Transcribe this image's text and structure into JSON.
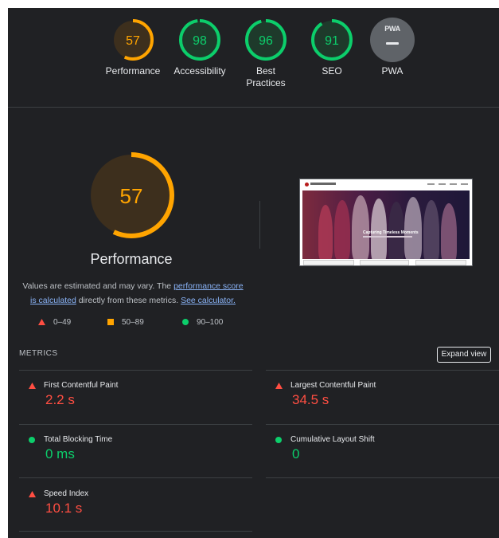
{
  "summary": {
    "gauges": [
      {
        "id": "performance",
        "score": 57,
        "label": "Performance",
        "color": "#ffa400",
        "fill": "#3d2f1d"
      },
      {
        "id": "accessibility",
        "score": 98,
        "label": "Accessibility",
        "color": "#0cce6b",
        "fill": "#1e3a2b"
      },
      {
        "id": "best_practices",
        "score": 96,
        "label": "Best Practices",
        "color": "#0cce6b",
        "fill": "#1e3a2b"
      },
      {
        "id": "seo",
        "score": 91,
        "label": "SEO",
        "color": "#0cce6b",
        "fill": "#1e3a2b"
      }
    ],
    "pwa": {
      "badge": "PWA",
      "label": "PWA"
    }
  },
  "performance": {
    "score": 57,
    "title": "Performance",
    "desc_prefix": "Values are estimated and may vary. The ",
    "link1": "performance score is calculated",
    "desc_middle": " directly from these metrics. ",
    "link2": "See calculator.",
    "legend": [
      {
        "shape": "triangle",
        "color": "#ff4e42",
        "range": "0–49"
      },
      {
        "shape": "square",
        "color": "#ffa400",
        "range": "50–89"
      },
      {
        "shape": "circle",
        "color": "#0cce6b",
        "range": "90–100"
      }
    ]
  },
  "screenshot": {
    "headline": "Capturing Timeless Moments"
  },
  "metrics": {
    "heading": "METRICS",
    "expand_label": "Expand view",
    "items": [
      {
        "name": "First Contentful Paint",
        "value": "2.2 s",
        "status": "fail",
        "color": "#ff4e42"
      },
      {
        "name": "Largest Contentful Paint",
        "value": "34.5 s",
        "status": "fail",
        "color": "#ff4e42"
      },
      {
        "name": "Total Blocking Time",
        "value": "0 ms",
        "status": "pass",
        "color": "#0cce6b"
      },
      {
        "name": "Cumulative Layout Shift",
        "value": "0",
        "status": "pass",
        "color": "#0cce6b"
      },
      {
        "name": "Speed Index",
        "value": "10.1 s",
        "status": "fail",
        "color": "#ff4e42"
      }
    ]
  }
}
